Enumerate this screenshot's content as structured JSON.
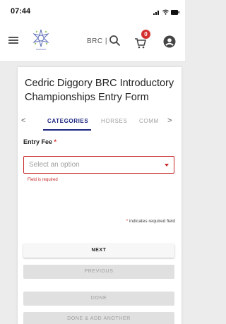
{
  "status_bar": {
    "time": "07:44"
  },
  "app_bar": {
    "brand_text": "BRC |",
    "cart_count": "0"
  },
  "form": {
    "title": "Cedric Diggory BRC Introductory Championships Entry Form",
    "tabs": [
      {
        "label": "CATEGORIES",
        "active": true
      },
      {
        "label": "HORSES",
        "active": false
      },
      {
        "label": "COMM",
        "active": false
      }
    ],
    "prev_arrow": "<",
    "next_arrow": ">",
    "entry_fee": {
      "label": "Entry Fee",
      "required_mark": "*",
      "placeholder": "Select an option",
      "error": "Field is required"
    },
    "required_note": "indicates required field",
    "required_note_star": "*",
    "buttons": {
      "next": "NEXT",
      "previous": "PREVIOUS",
      "done": "DONE",
      "done_add_another": "DONE & ADD ANOTHER"
    }
  },
  "colors": {
    "accent": "#1a237e",
    "error": "#c62828",
    "badge": "#d32f2f"
  }
}
